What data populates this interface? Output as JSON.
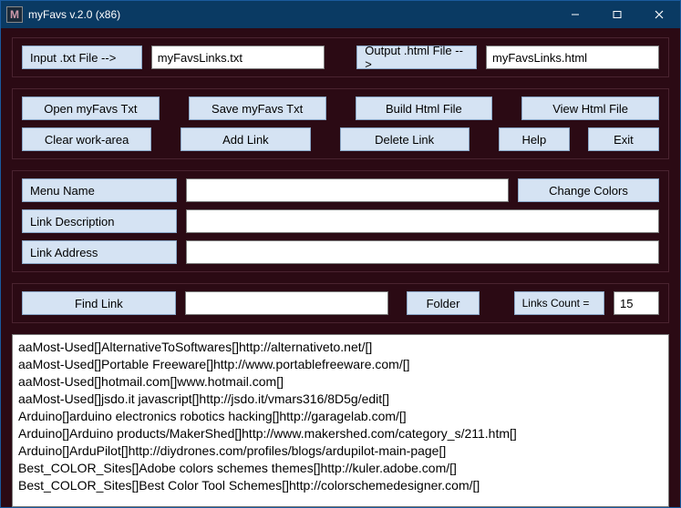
{
  "window": {
    "title": "myFavs v.2.0 (x86)",
    "icon_letter": "M"
  },
  "file_row": {
    "input_label": "Input .txt File -->",
    "input_value": "myFavsLinks.txt",
    "output_label": "Output .html File -->",
    "output_value": "myFavsLinks.html"
  },
  "buttons": {
    "open_txt": "Open myFavs Txt",
    "save_txt": "Save myFavs Txt",
    "build_html": "Build Html File",
    "view_html": "View Html File",
    "clear_work": "Clear work-area",
    "add_link": "Add Link",
    "delete_link": "Delete Link",
    "help": "Help",
    "exit": "Exit"
  },
  "form": {
    "menu_name_label": "Menu Name",
    "menu_name_value": "",
    "link_desc_label": "Link Description",
    "link_desc_value": "",
    "link_addr_label": "Link Address",
    "link_addr_value": "",
    "change_colors": "Change Colors"
  },
  "find": {
    "find_btn": "Find Link",
    "find_value": "",
    "folder_btn": "Folder",
    "count_label": "Links Count =",
    "count_value": "15"
  },
  "list": [
    "aaMost-Used[]AlternativeToSoftwares[]http://alternativeto.net/[]",
    "aaMost-Used[]Portable Freeware[]http://www.portablefreeware.com/[]",
    "aaMost-Used[]hotmail.com[]www.hotmail.com[]",
    "aaMost-Used[]jsdo.it javascript[]http://jsdo.it/vmars316/8D5g/edit[]",
    "Arduino[]arduino electronics robotics hacking[]http://garagelab.com/[]",
    "Arduino[]Arduino products/MakerShed[]http://www.makershed.com/category_s/211.htm[]",
    "Arduino[]ArduPilot[]http://diydrones.com/profiles/blogs/ardupilot-main-page[]",
    "Best_COLOR_Sites[]Adobe colors schemes themes[]http://kuler.adobe.com/[]",
    "Best_COLOR_Sites[]Best Color Tool Schemes[]http://colorschemedesigner.com/[]"
  ]
}
